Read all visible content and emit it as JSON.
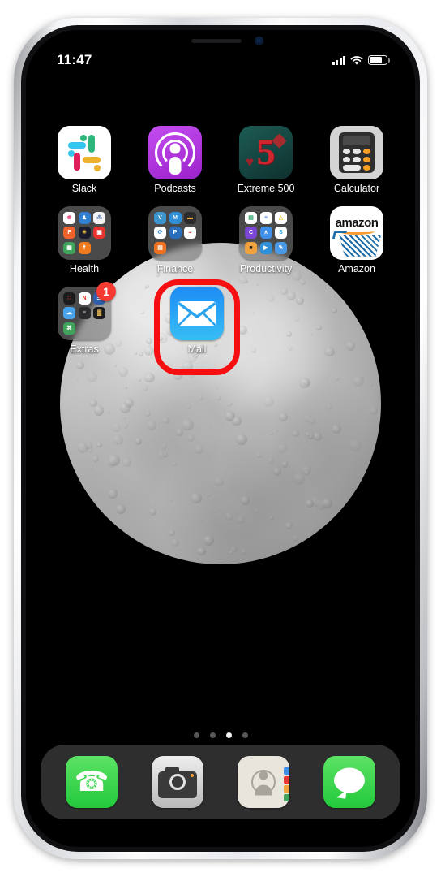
{
  "device": {
    "name": "iPhone",
    "frame_color": "#e9eaee"
  },
  "status_bar": {
    "time": "11:47",
    "signal_icon": "cellular-signal-icon",
    "wifi_icon": "wifi-icon",
    "battery_icon": "battery-icon",
    "battery_level": 78
  },
  "wallpaper": {
    "name": "moon-wallpaper",
    "background": "#000000"
  },
  "highlight": {
    "target": "Mail",
    "color": "#f50f10"
  },
  "home_screen": {
    "rows": [
      {
        "apps": [
          {
            "label": "Slack",
            "icon": "slack-icon",
            "type": "app"
          },
          {
            "label": "Podcasts",
            "icon": "podcasts-icon",
            "type": "app"
          },
          {
            "label": "Extreme 500",
            "icon": "extreme-500-icon",
            "type": "app"
          },
          {
            "label": "Calculator",
            "icon": "calculator-icon",
            "type": "app"
          }
        ]
      },
      {
        "apps": [
          {
            "label": "Health",
            "icon": "folder-icon",
            "type": "folder"
          },
          {
            "label": "Finance",
            "icon": "folder-icon",
            "type": "folder"
          },
          {
            "label": "Productivity",
            "icon": "folder-icon",
            "type": "folder"
          },
          {
            "label": "Amazon",
            "icon": "amazon-icon",
            "type": "app"
          }
        ]
      },
      {
        "apps": [
          {
            "label": "Extras",
            "icon": "folder-icon",
            "type": "folder",
            "badge": "1"
          },
          {
            "label": "Mail",
            "icon": "mail-icon",
            "type": "app",
            "highlighted": true
          }
        ]
      }
    ]
  },
  "folders": {
    "Health": [
      {
        "name": "app-1",
        "bg": "#ffffff",
        "fg": "#e8457c",
        "glyph": "❀"
      },
      {
        "name": "app-2",
        "bg": "#2f7fd1",
        "fg": "#ffffff",
        "glyph": "♟"
      },
      {
        "name": "app-3",
        "bg": "#f4f4f6",
        "fg": "#5d7fb0",
        "glyph": "⁂"
      },
      {
        "name": "app-4",
        "bg": "#f2622c",
        "fg": "#ffffff",
        "glyph": "F"
      },
      {
        "name": "app-5",
        "bg": "#1b1b2e",
        "fg": "#f5c542",
        "glyph": "✳"
      },
      {
        "name": "app-6",
        "bg": "#e8332f",
        "fg": "#ffffff",
        "glyph": "▣"
      },
      {
        "name": "app-7",
        "bg": "#3fa35b",
        "fg": "#ffffff",
        "glyph": "▦"
      },
      {
        "name": "app-8",
        "bg": "#f07a1e",
        "fg": "#ffffff",
        "glyph": "☨"
      }
    ],
    "Finance": [
      {
        "name": "venmo",
        "bg": "#3d95ce",
        "fg": "#ffffff",
        "glyph": "V"
      },
      {
        "name": "mint",
        "bg": "#2f8fd8",
        "fg": "#ffffff",
        "glyph": "M"
      },
      {
        "name": "wallet",
        "bg": "#2c2c2e",
        "fg": "#f0a33c",
        "glyph": "▬"
      },
      {
        "name": "chase",
        "bg": "#ffffff",
        "fg": "#1b77c4",
        "glyph": "⟳"
      },
      {
        "name": "paypal",
        "bg": "#2a6ebb",
        "fg": "#ffffff",
        "glyph": "P"
      },
      {
        "name": "amex",
        "bg": "#ffffff",
        "fg": "#cf2630",
        "glyph": "≈"
      },
      {
        "name": "invest",
        "bg": "#f0701e",
        "fg": "#ffffff",
        "glyph": "▤"
      }
    ],
    "Productivity": [
      {
        "name": "sheets",
        "bg": "#ffffff",
        "fg": "#29a366",
        "glyph": "▤"
      },
      {
        "name": "docs",
        "bg": "#ffffff",
        "fg": "#3f7ee0",
        "glyph": "≡"
      },
      {
        "name": "drive",
        "bg": "#ffffff",
        "fg": "#f5c542",
        "glyph": "△"
      },
      {
        "name": "c-app",
        "bg": "#7b46d6",
        "fg": "#ffffff",
        "glyph": "C"
      },
      {
        "name": "arrow",
        "bg": "#3f8ee8",
        "fg": "#ffffff",
        "glyph": "∧"
      },
      {
        "name": "skype",
        "bg": "#ffffff",
        "fg": "#2aa3e8",
        "glyph": "S"
      },
      {
        "name": "dark",
        "bg": "#f0a33c",
        "fg": "#1a1a1a",
        "glyph": "■"
      },
      {
        "name": "zoom",
        "bg": "#2f8fd8",
        "fg": "#ffffff",
        "glyph": "▶"
      },
      {
        "name": "blue",
        "bg": "#4a9ae8",
        "fg": "#ffffff",
        "glyph": "✎"
      }
    ],
    "Extras": [
      {
        "name": "dark-grid",
        "bg": "#1c1c1e",
        "fg": "#e8332f",
        "glyph": "∷"
      },
      {
        "name": "news",
        "bg": "#ffffff",
        "fg": "#e8332f",
        "glyph": "N"
      },
      {
        "name": "weather-c",
        "bg": "#2f5fa8",
        "fg": "#ffffff",
        "glyph": "☰"
      },
      {
        "name": "weather",
        "bg": "#4aa3e8",
        "fg": "#ffffff",
        "glyph": "☁"
      },
      {
        "name": "stripes",
        "bg": "#2c2c2e",
        "fg": "#c9c9c9",
        "glyph": "≡"
      },
      {
        "name": "tool",
        "bg": "#1c1c1e",
        "fg": "#f0c060",
        "glyph": "▓"
      },
      {
        "name": "green",
        "bg": "#3fa35b",
        "fg": "#ffffff",
        "glyph": "⌘"
      }
    ]
  },
  "page_dots": {
    "count": 4,
    "active_index": 2
  },
  "dock": {
    "apps": [
      {
        "label": "Phone",
        "icon": "phone-icon"
      },
      {
        "label": "Camera",
        "icon": "camera-icon"
      },
      {
        "label": "Contacts",
        "icon": "contacts-icon"
      },
      {
        "label": "Messages",
        "icon": "messages-icon"
      }
    ]
  }
}
